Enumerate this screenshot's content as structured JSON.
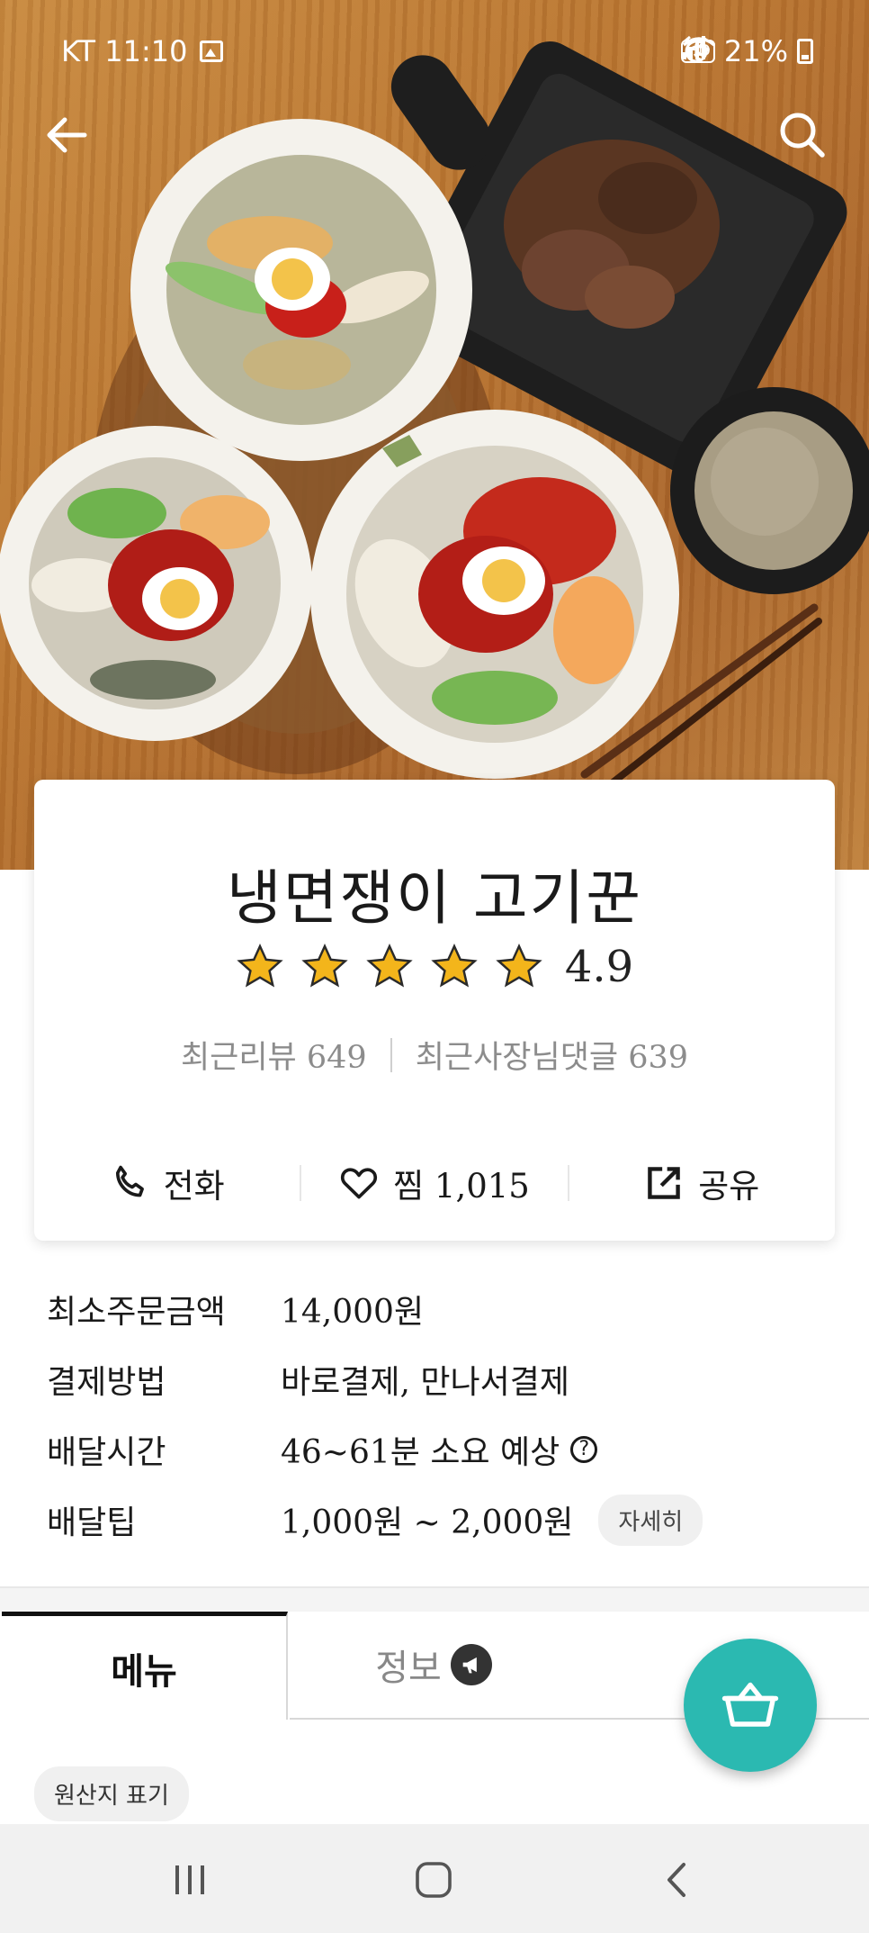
{
  "status_bar": {
    "carrier_time": "KT 11:10",
    "battery": "21%",
    "network_badge": "HD"
  },
  "store": {
    "name": "냉면쟁이 고기꾼",
    "rating": "4.9",
    "stars": 5,
    "recent_reviews_label": "최근리뷰 649",
    "owner_replies_label": "최근사장님댓글 639"
  },
  "actions": {
    "call": "전화",
    "favorite": "찜 1,015",
    "share": "공유"
  },
  "details": {
    "min_order_label": "최소주문금액",
    "min_order_value": "14,000원",
    "payment_label": "결제방법",
    "payment_value": "바로결제, 만나서결제",
    "delivery_time_label": "배달시간",
    "delivery_time_value": "46~61분 소요 예상",
    "delivery_tip_label": "배달팁",
    "delivery_tip_value": "1,000원 ~ 2,000원",
    "delivery_tip_more": "자세히"
  },
  "tabs": {
    "menu": "메뉴",
    "info": "정보"
  },
  "origin_chip": "원산지 표기",
  "colors": {
    "accent": "#2bb9b1",
    "star": "#f3b51b"
  }
}
